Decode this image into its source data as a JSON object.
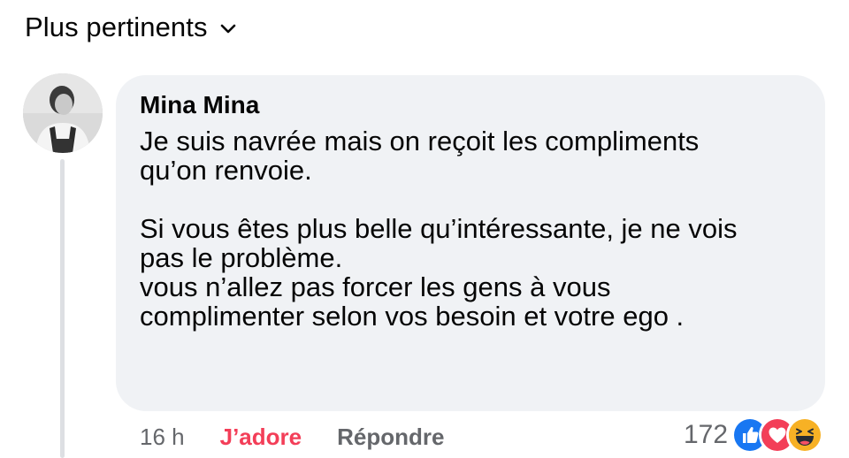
{
  "sort": {
    "label": "Plus pertinents",
    "icon": "chevron-down-icon"
  },
  "comment": {
    "author": "Mina Mina",
    "text": "Je suis navrée mais on reçoit les compliments\nqu’on renvoie.\n\nSi vous êtes plus belle qu’intéressante, je ne vois\npas le problème.\nvous n’allez pas forcer les gens à vous\ncomplimenter selon vos besoin et votre ego .",
    "time": "16 h",
    "reaction_action": "J’adore",
    "reply_action": "Répondre",
    "reaction_count": "172",
    "reactions": [
      "like-icon",
      "love-icon",
      "haha-icon"
    ]
  },
  "colors": {
    "bubble": "#f0f2f5",
    "love": "#f33e58",
    "meta": "#65676b",
    "like": "#1877f2",
    "haha": "#f7b125"
  }
}
